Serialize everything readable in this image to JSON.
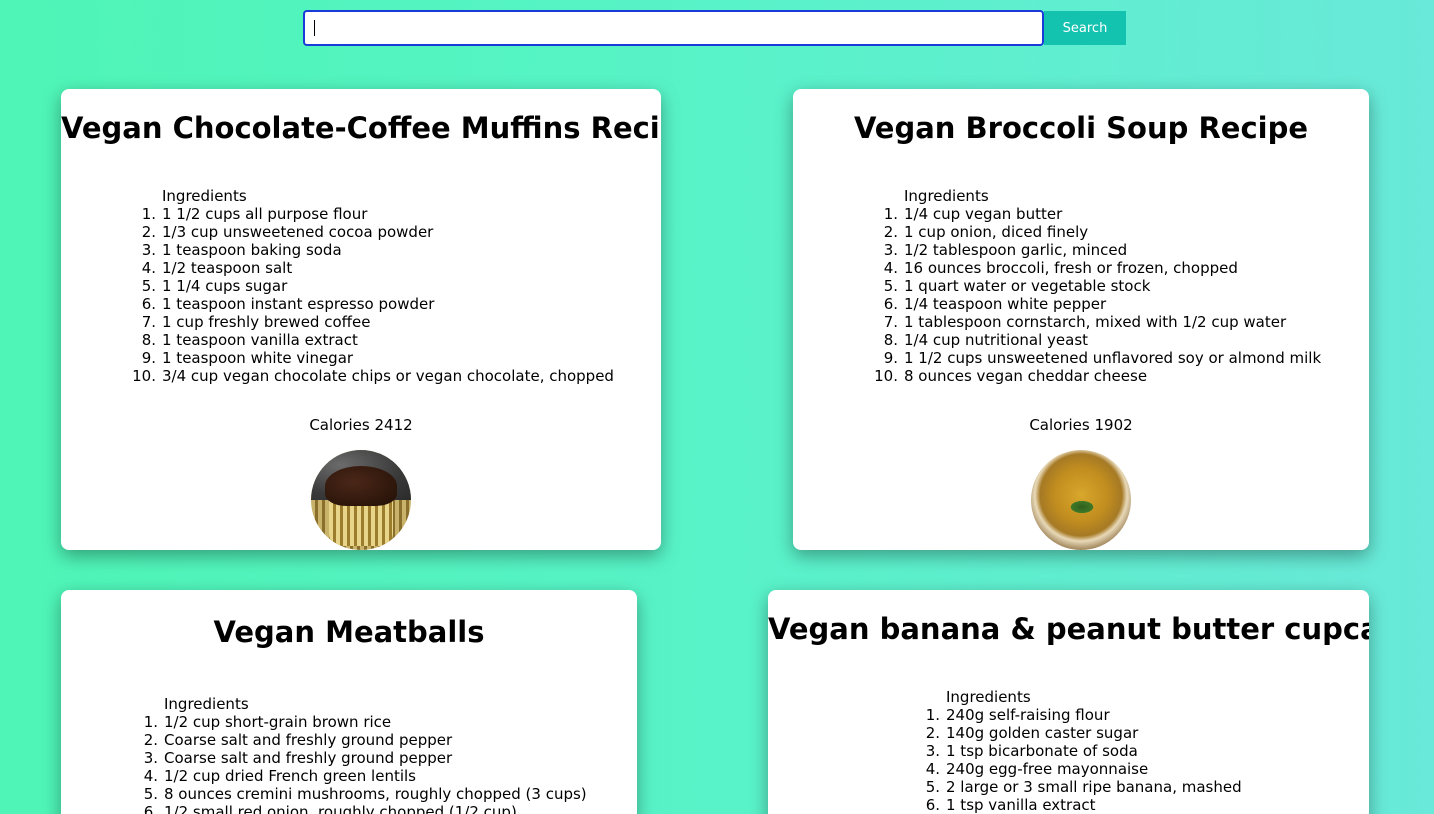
{
  "search": {
    "placeholder": "",
    "value": "",
    "button_label": "Search"
  },
  "recipes": [
    {
      "title": "Vegan Chocolate-Coffee Muffins Recipe",
      "ingredients_label": "Ingredients",
      "ingredients": [
        "1 1/2 cups all purpose flour",
        "1/3 cup unsweetened cocoa powder",
        "1 teaspoon baking soda",
        "1/2 teaspoon salt",
        "1 1/4 cups sugar",
        "1 teaspoon instant espresso powder",
        "1 cup freshly brewed coffee",
        "1 teaspoon vanilla extract",
        "1 teaspoon white vinegar",
        "3/4 cup vegan chocolate chips or vegan chocolate, chopped"
      ],
      "calories": "Calories 2412",
      "image": "chocolate-muffin-photo"
    },
    {
      "title": "Vegan Broccoli Soup Recipe",
      "ingredients_label": "Ingredients",
      "ingredients": [
        "1/4 cup vegan butter",
        "1 cup onion, diced finely",
        "1/2 tablespoon garlic, minced",
        "16 ounces broccoli, fresh or frozen, chopped",
        "1 quart water or vegetable stock",
        "1/4 teaspoon white pepper",
        "1 tablespoon cornstarch, mixed with 1/2 cup water",
        "1/4 cup nutritional yeast",
        "1 1/2 cups unsweetened unflavored soy or almond milk",
        "8 ounces vegan cheddar cheese"
      ],
      "calories": "Calories 1902",
      "image": "broccoli-soup-photo"
    },
    {
      "title": "Vegan Meatballs",
      "ingredients_label": "Ingredients",
      "ingredients": [
        "1/2 cup short-grain brown rice",
        "Coarse salt and freshly ground pepper",
        "Coarse salt and freshly ground pepper",
        "1/2 cup dried French green lentils",
        "8 ounces cremini mushrooms, roughly chopped (3 cups)",
        "1/2 small red onion, roughly chopped (1/2 cup)"
      ]
    },
    {
      "title": "Vegan banana & peanut butter cupcakes",
      "ingredients_label": "Ingredients",
      "ingredients": [
        "240g self-raising flour",
        "140g golden caster sugar",
        "1 tsp bicarbonate of soda",
        "240g egg-free mayonnaise",
        "2 large or 3 small ripe banana, mashed",
        "1 tsp vanilla extract"
      ]
    }
  ]
}
